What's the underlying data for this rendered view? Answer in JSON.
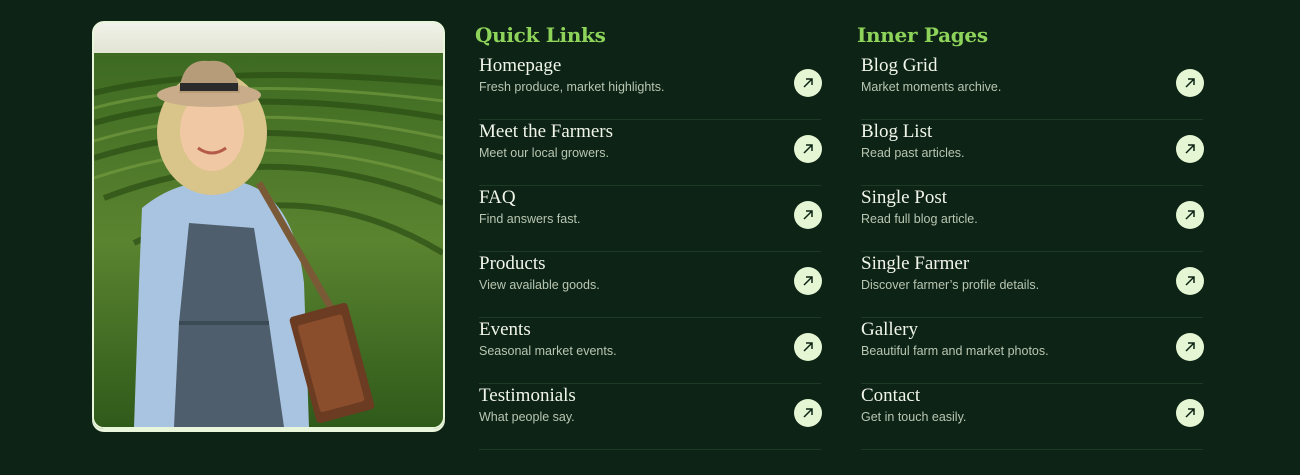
{
  "quick_links": {
    "title": "Quick Links",
    "items": [
      {
        "title": "Homepage",
        "desc": "Fresh produce, market highlights."
      },
      {
        "title": "Meet the Farmers",
        "desc": "Meet our local growers."
      },
      {
        "title": "FAQ",
        "desc": "Find answers fast."
      },
      {
        "title": "Products",
        "desc": "View available goods."
      },
      {
        "title": "Events",
        "desc": "Seasonal market events."
      },
      {
        "title": "Testimonials",
        "desc": "What people say."
      }
    ]
  },
  "inner_pages": {
    "title": "Inner Pages",
    "items": [
      {
        "title": "Blog Grid",
        "desc": "Market moments archive."
      },
      {
        "title": "Blog List",
        "desc": "Read past articles."
      },
      {
        "title": "Single Post",
        "desc": "Read full blog article."
      },
      {
        "title": "Single Farmer",
        "desc": "Discover farmer’s profile details."
      },
      {
        "title": "Gallery",
        "desc": "Beautiful farm and market photos."
      },
      {
        "title": "Contact",
        "desc": "Get in touch easily."
      }
    ]
  },
  "colors": {
    "background": "#0d2315",
    "heading_accent": "#8fd45a",
    "button_bg": "#e4f6d4",
    "divider": "#1d3a25"
  },
  "icons": {
    "link_button": "arrow-up-right-icon"
  }
}
